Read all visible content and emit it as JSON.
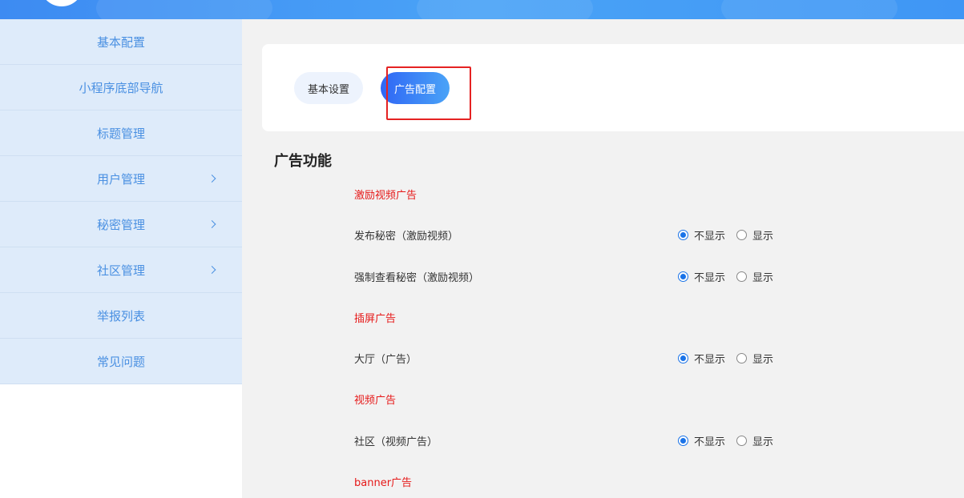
{
  "colors": {
    "accent": "#1a73e8",
    "sidebar_text": "#4a90e2",
    "red_subtitle": "#e61919",
    "highlight_box": "#e52222"
  },
  "sidebar": {
    "items": [
      {
        "label": "基本配置",
        "has_submenu": false
      },
      {
        "label": "小程序底部导航",
        "has_submenu": false
      },
      {
        "label": "标题管理",
        "has_submenu": false
      },
      {
        "label": "用户管理",
        "has_submenu": true
      },
      {
        "label": "秘密管理",
        "has_submenu": true
      },
      {
        "label": "社区管理",
        "has_submenu": true
      },
      {
        "label": "举报列表",
        "has_submenu": false
      },
      {
        "label": "常见问题",
        "has_submenu": false
      }
    ]
  },
  "tabs": [
    {
      "label": "基本设置",
      "active": false
    },
    {
      "label": "广告配置",
      "active": true
    }
  ],
  "section": {
    "title": "广告功能",
    "groups": [
      {
        "subtitle": "激励视频广告"
      },
      {
        "subtitle": "插屏广告"
      },
      {
        "subtitle": "视频广告"
      },
      {
        "subtitle": "banner广告"
      }
    ],
    "rows": [
      {
        "label": "发布秘密（激励视频）",
        "selected": "不显示"
      },
      {
        "label": "强制查看秘密（激励视频）",
        "selected": "不显示"
      },
      {
        "label": "大厅（广告）",
        "selected": "不显示"
      },
      {
        "label": "社区（视频广告）",
        "selected": "不显示"
      }
    ],
    "option_hide": "不显示",
    "option_show": "显示"
  }
}
